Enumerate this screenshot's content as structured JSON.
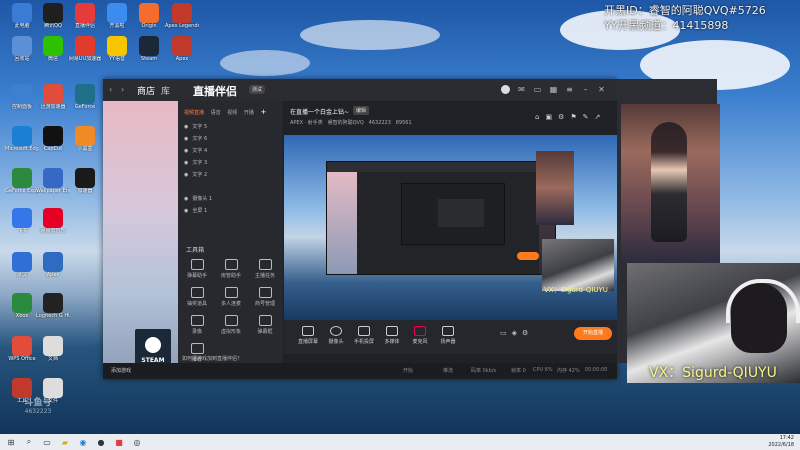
{
  "overlay": {
    "line1": "开黑ID：睿智的阿聪QVQ#5726",
    "line2": "YY开黑频道：41415898"
  },
  "desktop_icons": [
    {
      "label": "此电脑",
      "icon": "computer-icon",
      "color": "#3a7bd5"
    },
    {
      "label": "腾讯QQ",
      "icon": "qq-icon",
      "color": "#1f1f1f"
    },
    {
      "label": "直播伴侣",
      "icon": "live-companion-icon",
      "color": "#e53b3b"
    },
    {
      "label": "开黑啦",
      "icon": "game-chat-icon",
      "color": "#3c8cf0"
    },
    {
      "label": "Origin",
      "icon": "origin-icon",
      "color": "#f56c2d"
    },
    {
      "label": "Apex Legends",
      "icon": "apex-icon",
      "color": "#c0392b"
    },
    {
      "label": "回收站",
      "icon": "recycle-bin-icon",
      "color": "#5c8fd6"
    },
    {
      "label": "微信",
      "icon": "wechat-icon",
      "color": "#2dc100"
    },
    {
      "label": "网易UU加速器",
      "icon": "uu-accelerator-icon",
      "color": "#e23b2e"
    },
    {
      "label": "YY语音",
      "icon": "yy-icon",
      "color": "#f7c600"
    },
    {
      "label": "Steam",
      "icon": "steam-icon",
      "color": "#1b2838"
    },
    {
      "label": "Apex",
      "icon": "apex-icon",
      "color": "#c0392b"
    },
    {
      "label": "控制面板",
      "icon": "control-panel-icon",
      "color": "#3d7fd1"
    },
    {
      "label": "迅游加速器",
      "icon": "accelerator-icon",
      "color": "#e24d3b"
    },
    {
      "label": "GeForce",
      "icon": "geforce-icon",
      "color": "#1f6f8b"
    },
    {
      "label": "Microsoft Edge",
      "icon": "edge-icon",
      "color": "#1b7fd3"
    },
    {
      "label": "CapCut",
      "icon": "capcut-icon",
      "color": "#111111"
    },
    {
      "label": "小黑盒",
      "icon": "box-icon",
      "color": "#f08a24"
    },
    {
      "label": "GeForce Experience",
      "icon": "nvidia-icon",
      "color": "#2b8a3e"
    },
    {
      "label": "Wallpaper Engine",
      "icon": "wallpaper-icon",
      "color": "#3768c8"
    },
    {
      "label": "加速器",
      "icon": "boost-icon",
      "color": "#1a1a1a"
    },
    {
      "label": "飞书",
      "icon": "feishu-icon",
      "color": "#3576e8"
    },
    {
      "label": "网易云音乐",
      "icon": "cloud-music-icon",
      "color": "#e60026"
    },
    {
      "label": "录屏",
      "icon": "recorder-icon",
      "color": "#2f6fd6"
    },
    {
      "label": "Apex",
      "icon": "apex-icon",
      "color": "#2d6cc0"
    },
    {
      "label": "Xbox",
      "icon": "xbox-icon",
      "color": "#2b8a3e"
    },
    {
      "label": "Logitech G HUB",
      "icon": "logitech-icon",
      "color": "#222222"
    },
    {
      "label": "WPS Office",
      "icon": "wps-icon",
      "color": "#e24d3b"
    },
    {
      "label": "文档",
      "icon": "document-icon",
      "color": "#dddddd"
    },
    {
      "label": "工具",
      "icon": "tools-icon",
      "color": "#c0392b"
    },
    {
      "label": "文件",
      "icon": "file-icon",
      "color": "#dddddd"
    }
  ],
  "app": {
    "title": "直播伴侣",
    "badge": "测试",
    "store_tabs": [
      "商店",
      "库"
    ],
    "panel_tabs": [
      "视频直播",
      "语音",
      "视频",
      "开播"
    ],
    "sources": [
      "文字 5",
      "文字 6",
      "文字 4",
      "文字 3",
      "文字 2",
      "摄像头 1",
      "全屏 1"
    ],
    "tools_title": "工具箱",
    "tools": [
      "弹幕助手",
      "房管助手",
      "主播任务",
      "抽奖道具",
      "多人连麦",
      "商号管理",
      "录像",
      "虚拟形象",
      "弹幕框",
      "推荐"
    ],
    "add_tip": "如何把游戏加到直播伴侣？",
    "add_game": "添加游戏",
    "header_title": "在直播一个白金上钻~",
    "header_tag": "编辑",
    "header_meta": [
      "APEX · 射手类",
      "睿智的阿聪QVQ",
      "4632223",
      "89561"
    ],
    "steam_label": "STEAM",
    "bottom_buttons": [
      "直播屏幕",
      "摄像头",
      "手机投屏",
      "多媒体",
      "麦克风",
      "扬声器"
    ],
    "live_button": "开始直播",
    "status": [
      "推流",
      "码率 0kb/s",
      "帧率 0",
      "CPU 6%",
      "内存 42%",
      "00:00:00"
    ],
    "center_label": "开始"
  },
  "cam_label": "VX：Sigurd-QIUYU",
  "inner_cam_label": "VX：Sigurd-QIUYU",
  "taskbar": {
    "time": "17:42",
    "date": "2022/6/18"
  },
  "watermark": {
    "line1": "斗鱼号",
    "line2": "4632223"
  }
}
